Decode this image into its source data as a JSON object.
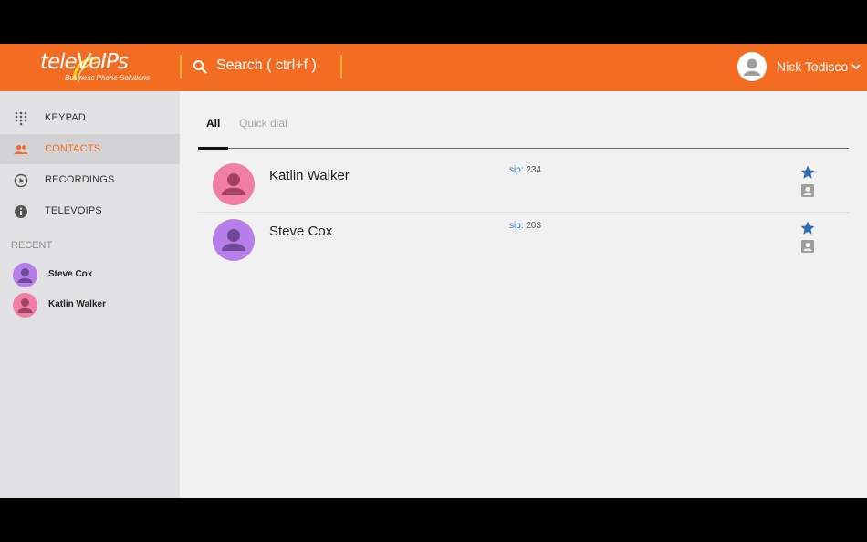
{
  "brand": {
    "logo_text": "teleVoIPs",
    "logo_tagline": "Business Phone Solutions",
    "primary_color": "#f26d21"
  },
  "header": {
    "search_placeholder": "Search ( ctrl+f )",
    "user_name": "Nick Todisco"
  },
  "sidebar": {
    "items": [
      {
        "label": "KEYPAD",
        "icon": "keypad-icon"
      },
      {
        "label": "CONTACTS",
        "icon": "contacts-icon"
      },
      {
        "label": "RECORDINGS",
        "icon": "play-circle-icon"
      },
      {
        "label": "TELEVOIPS",
        "icon": "info-icon"
      }
    ],
    "active_index": 1,
    "recent_title": "RECENT",
    "recent": [
      {
        "name": "Steve Cox",
        "color": "#b57ee8"
      },
      {
        "name": "Katlin Walker",
        "color": "#f07ea6"
      }
    ]
  },
  "main": {
    "tabs": [
      {
        "label": "All"
      },
      {
        "label": "Quick dial"
      }
    ],
    "active_tab": 0,
    "contacts": [
      {
        "name": "Katlin Walker",
        "sip_label": "sip:",
        "sip_value": "234",
        "avatar_color": "#f07ea6",
        "favorite": true
      },
      {
        "name": "Steve Cox",
        "sip_label": "sip:",
        "sip_value": "203",
        "avatar_color": "#b57ee8",
        "favorite": true
      }
    ],
    "accent_blue": "#2f6cb3"
  }
}
